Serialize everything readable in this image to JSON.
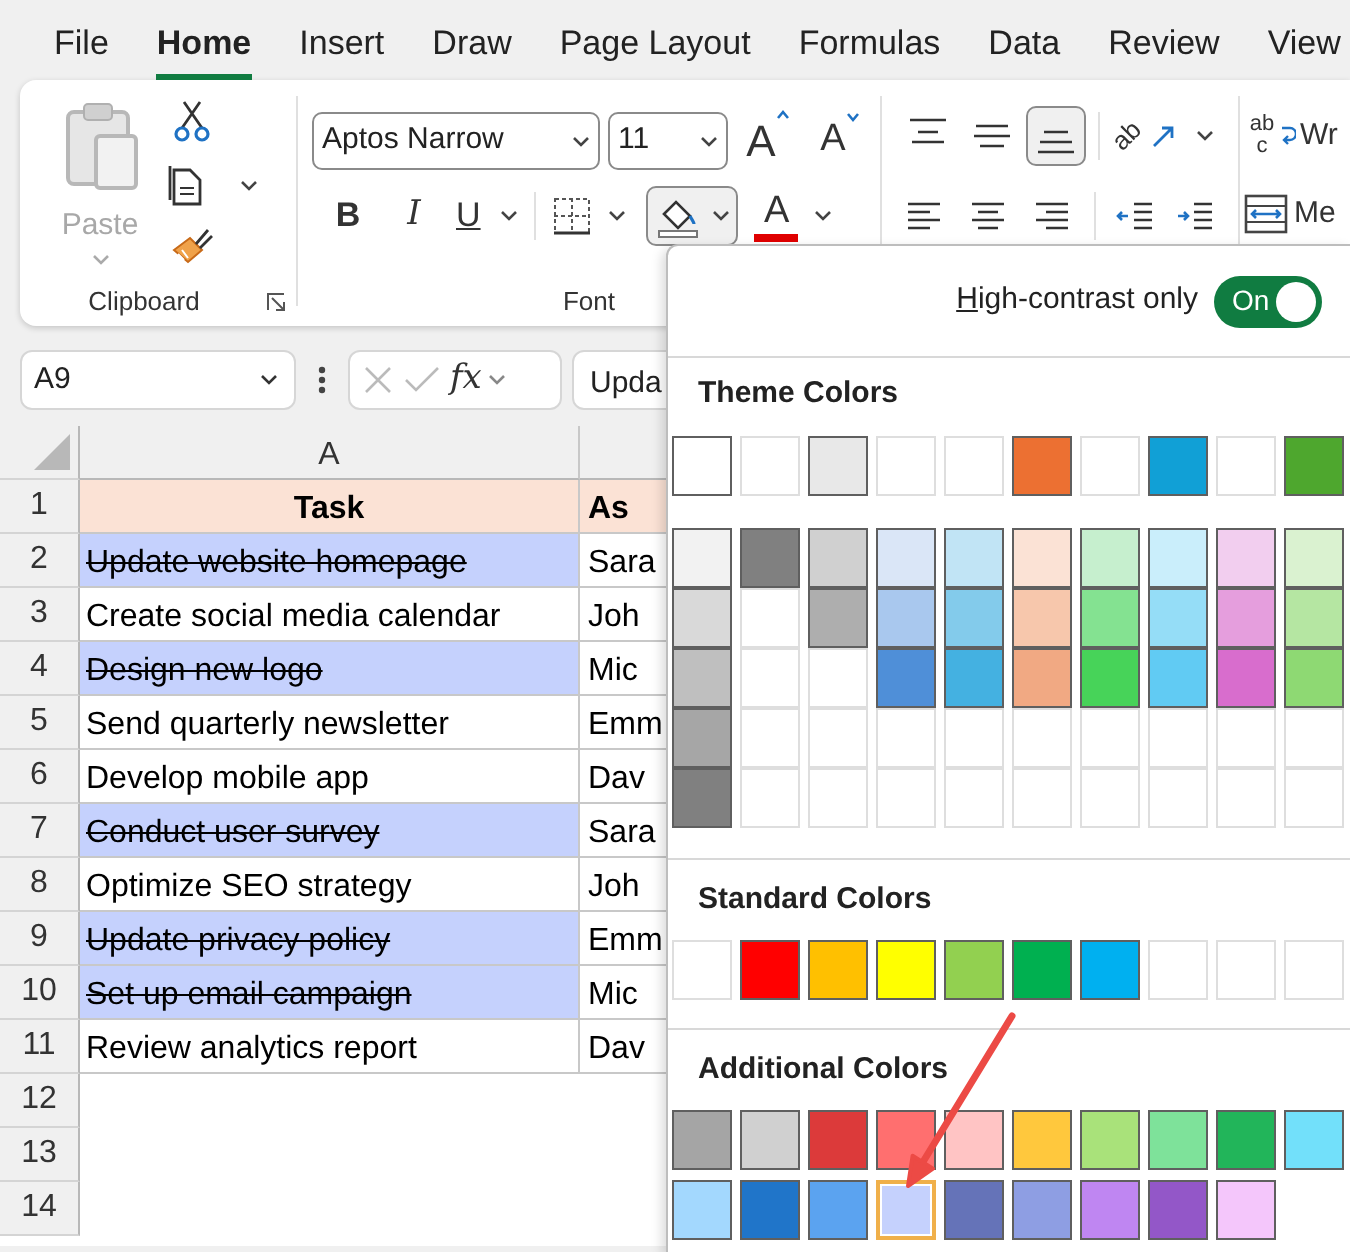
{
  "menu_tabs": [
    {
      "label": "File",
      "selected": false
    },
    {
      "label": "Home",
      "selected": true
    },
    {
      "label": "Insert",
      "selected": false
    },
    {
      "label": "Draw",
      "selected": false
    },
    {
      "label": "Page Layout",
      "selected": false
    },
    {
      "label": "Formulas",
      "selected": false
    },
    {
      "label": "Data",
      "selected": false
    },
    {
      "label": "Review",
      "selected": false
    },
    {
      "label": "View",
      "selected": false
    }
  ],
  "ribbon": {
    "clipboard": {
      "paste_label": "Paste",
      "paste_disabled": true,
      "group_label": "Clipboard"
    },
    "font": {
      "font_name": "Aptos Narrow",
      "font_size": "11",
      "grow_label": "A",
      "shrink_label": "A",
      "bold_label": "B",
      "italic_label": "I",
      "underline_label": "U",
      "fill_color_open": true,
      "font_color_label": "A",
      "group_label": "Font"
    },
    "alignment": {
      "vertical": [
        {
          "kind": "top",
          "selected": false
        },
        {
          "kind": "middle",
          "selected": false
        },
        {
          "kind": "bottom",
          "selected": true
        }
      ],
      "orientation_glyph": "ab"
    },
    "wrap": {
      "wrap_glyph": "abc",
      "wrap_label": "Wr",
      "merge_label": "Me"
    }
  },
  "formula_bar": {
    "name_box": "A9",
    "fx_label": "fx",
    "value": "Upda"
  },
  "sheet": {
    "column_headers": [
      "A"
    ],
    "header_row": {
      "number": "1",
      "cells": [
        "Task",
        "As"
      ]
    },
    "rows": [
      {
        "number": "2",
        "task": "Update website homepage",
        "assignee": "Sara",
        "done": true
      },
      {
        "number": "3",
        "task": "Create social media calendar",
        "assignee": "Joh",
        "done": false
      },
      {
        "number": "4",
        "task": "Design new logo",
        "assignee": "Mic",
        "done": true
      },
      {
        "number": "5",
        "task": "Send quarterly newsletter",
        "assignee": "Emm",
        "done": false
      },
      {
        "number": "6",
        "task": "Develop mobile app",
        "assignee": "Dav",
        "done": false
      },
      {
        "number": "7",
        "task": "Conduct user survey",
        "assignee": "Sara",
        "done": true
      },
      {
        "number": "8",
        "task": "Optimize SEO strategy",
        "assignee": "Joh",
        "done": false
      },
      {
        "number": "9",
        "task": "Update privacy policy",
        "assignee": "Emm",
        "done": true
      },
      {
        "number": "10",
        "task": "Set up email campaign",
        "assignee": "Mic",
        "done": true
      },
      {
        "number": "11",
        "task": "Review analytics report",
        "assignee": "Dav",
        "done": false
      }
    ],
    "empty_rows": [
      "12",
      "13",
      "14"
    ]
  },
  "color_menu": {
    "high_contrast": {
      "label": "High-contrast only",
      "underline_first_letter": true,
      "on": true,
      "state_label": "On"
    },
    "theme_title": "Theme Colors",
    "theme_row": [
      {
        "kind": "color",
        "color": "#ffffff"
      },
      {
        "kind": "blank"
      },
      {
        "kind": "color",
        "color": "#e8e8e8"
      },
      {
        "kind": "blank"
      },
      {
        "kind": "blank"
      },
      {
        "kind": "color",
        "color": "#ec7032"
      },
      {
        "kind": "blank"
      },
      {
        "kind": "color",
        "color": "#11a0d6"
      },
      {
        "kind": "blank"
      },
      {
        "kind": "color",
        "color": "#4ea72e"
      }
    ],
    "theme_shades": [
      [
        {
          "kind": "color",
          "color": "#f2f2f2"
        },
        {
          "kind": "color",
          "color": "#d9d9d9"
        },
        {
          "kind": "color",
          "color": "#bfbfbf"
        },
        {
          "kind": "color",
          "color": "#a6a6a6"
        },
        {
          "kind": "color",
          "color": "#808080"
        }
      ],
      [
        {
          "kind": "color",
          "color": "#808080"
        },
        {
          "kind": "blank"
        },
        {
          "kind": "blank"
        },
        {
          "kind": "blank"
        },
        {
          "kind": "blank"
        }
      ],
      [
        {
          "kind": "color",
          "color": "#d0d0d0"
        },
        {
          "kind": "color",
          "color": "#aeaeae"
        },
        {
          "kind": "blank"
        },
        {
          "kind": "blank"
        },
        {
          "kind": "blank"
        }
      ],
      [
        {
          "kind": "color",
          "color": "#dae6f7"
        },
        {
          "kind": "color",
          "color": "#a9c8ee"
        },
        {
          "kind": "color",
          "color": "#4f8fd8"
        },
        {
          "kind": "blank"
        },
        {
          "kind": "blank"
        }
      ],
      [
        {
          "kind": "color",
          "color": "#c1e4f5"
        },
        {
          "kind": "color",
          "color": "#83cbeb"
        },
        {
          "kind": "color",
          "color": "#44b1e1"
        },
        {
          "kind": "blank"
        },
        {
          "kind": "blank"
        }
      ],
      [
        {
          "kind": "color",
          "color": "#fbe2d5"
        },
        {
          "kind": "color",
          "color": "#f7c7ac"
        },
        {
          "kind": "color",
          "color": "#f1a983"
        },
        {
          "kind": "blank"
        },
        {
          "kind": "blank"
        }
      ],
      [
        {
          "kind": "color",
          "color": "#c6efce"
        },
        {
          "kind": "color",
          "color": "#84e291"
        },
        {
          "kind": "color",
          "color": "#47d359"
        },
        {
          "kind": "blank"
        },
        {
          "kind": "blank"
        }
      ],
      [
        {
          "kind": "color",
          "color": "#caeefb"
        },
        {
          "kind": "color",
          "color": "#95ddf7"
        },
        {
          "kind": "color",
          "color": "#61cbf3"
        },
        {
          "kind": "blank"
        },
        {
          "kind": "blank"
        }
      ],
      [
        {
          "kind": "color",
          "color": "#f2ceef"
        },
        {
          "kind": "color",
          "color": "#e59edd"
        },
        {
          "kind": "color",
          "color": "#d86dcd"
        },
        {
          "kind": "blank"
        },
        {
          "kind": "blank"
        }
      ],
      [
        {
          "kind": "color",
          "color": "#daf2d0"
        },
        {
          "kind": "color",
          "color": "#b5e6a2"
        },
        {
          "kind": "color",
          "color": "#8ed973"
        },
        {
          "kind": "blank"
        },
        {
          "kind": "blank"
        }
      ]
    ],
    "standard_title": "Standard Colors",
    "standard": [
      {
        "kind": "blank"
      },
      {
        "kind": "color",
        "color": "#ff0000"
      },
      {
        "kind": "color",
        "color": "#ffc000"
      },
      {
        "kind": "color",
        "color": "#ffff00"
      },
      {
        "kind": "color",
        "color": "#92d050"
      },
      {
        "kind": "color",
        "color": "#00b050"
      },
      {
        "kind": "color",
        "color": "#00b0f0"
      },
      {
        "kind": "blank"
      },
      {
        "kind": "blank"
      },
      {
        "kind": "blank"
      }
    ],
    "additional_title": "Additional Colors",
    "additional": [
      {
        "kind": "color",
        "color": "#a5a5a5",
        "selected": false
      },
      {
        "kind": "color",
        "color": "#d0d0d0",
        "selected": false
      },
      {
        "kind": "color",
        "color": "#dc3a3a",
        "selected": false
      },
      {
        "kind": "color",
        "color": "#ff6f6f",
        "selected": false
      },
      {
        "kind": "color",
        "color": "#ffc4c4",
        "selected": false
      },
      {
        "kind": "color",
        "color": "#ffc83d",
        "selected": false
      },
      {
        "kind": "color",
        "color": "#a9e27a",
        "selected": false
      },
      {
        "kind": "color",
        "color": "#7ee29a",
        "selected": false
      },
      {
        "kind": "color",
        "color": "#22b55a",
        "selected": false
      },
      {
        "kind": "color",
        "color": "#72e0fa",
        "selected": false
      },
      {
        "kind": "color",
        "color": "#a3d8fe",
        "selected": false
      },
      {
        "kind": "color",
        "color": "#2075c9",
        "selected": false
      },
      {
        "kind": "color",
        "color": "#5ba3f0",
        "selected": false
      },
      {
        "kind": "color",
        "color": "#c5d1fd",
        "selected": true
      },
      {
        "kind": "color",
        "color": "#6573b8",
        "selected": false
      },
      {
        "kind": "color",
        "color": "#8e9ee3",
        "selected": false
      },
      {
        "kind": "color",
        "color": "#bf86f2",
        "selected": false
      },
      {
        "kind": "color",
        "color": "#9357c8",
        "selected": false
      },
      {
        "kind": "color",
        "color": "#f4c6fb",
        "selected": false
      }
    ]
  }
}
